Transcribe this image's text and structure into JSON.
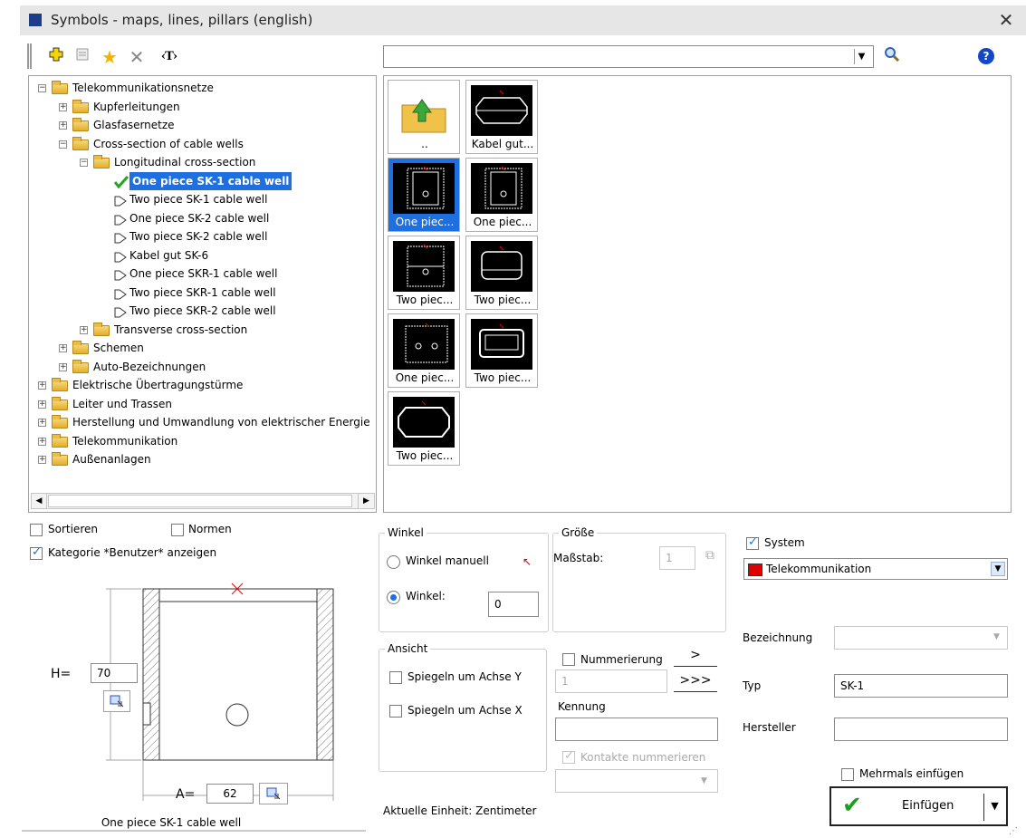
{
  "window": {
    "title": "Symbols - maps, lines, pillars (english)"
  },
  "toolbar": {
    "text_tool": "‹T›"
  },
  "search": {
    "placeholder": ""
  },
  "tree": {
    "items": [
      {
        "label": "Telekommunikationsnetze",
        "level": 0,
        "type": "folder",
        "expanded": true
      },
      {
        "label": "Kupferleitungen",
        "level": 1,
        "type": "folder",
        "expanded": false
      },
      {
        "label": "Glasfasernetze",
        "level": 1,
        "type": "folder",
        "expanded": false
      },
      {
        "label": "Cross-section of cable wells",
        "level": 1,
        "type": "folder",
        "expanded": true
      },
      {
        "label": "Longitudinal cross-section",
        "level": 2,
        "type": "folder",
        "expanded": true
      },
      {
        "label": "One piece SK-1 cable well",
        "level": 3,
        "type": "symbol",
        "selected": true
      },
      {
        "label": "Two piece SK-1 cable well",
        "level": 3,
        "type": "symbol"
      },
      {
        "label": "One piece SK-2 cable well",
        "level": 3,
        "type": "symbol"
      },
      {
        "label": "Two piece SK-2 cable well",
        "level": 3,
        "type": "symbol"
      },
      {
        "label": "Kabel gut SK-6",
        "level": 3,
        "type": "symbol"
      },
      {
        "label": "One piece SKR-1 cable well",
        "level": 3,
        "type": "symbol"
      },
      {
        "label": "Two piece SKR-1 cable well",
        "level": 3,
        "type": "symbol"
      },
      {
        "label": "Two piece SKR-2 cable well",
        "level": 3,
        "type": "symbol"
      },
      {
        "label": "Transverse cross-section",
        "level": 2,
        "type": "folder",
        "expanded": false
      },
      {
        "label": "Schemen",
        "level": 1,
        "type": "folder",
        "expanded": false
      },
      {
        "label": "Auto-Bezeichnungen",
        "level": 1,
        "type": "folder",
        "expanded": false
      },
      {
        "label": "Elektrische Übertragungstürme",
        "level": 0,
        "type": "folder",
        "expanded": false
      },
      {
        "label": "Leiter und Trassen",
        "level": 0,
        "type": "folder",
        "expanded": false
      },
      {
        "label": "Herstellung und Umwandlung von elektrischer Energie",
        "level": 0,
        "type": "folder",
        "expanded": false
      },
      {
        "label": "Telekommunikation",
        "level": 0,
        "type": "folder",
        "expanded": false
      },
      {
        "label": "Außenanlagen",
        "level": 0,
        "type": "folder",
        "expanded": false
      }
    ]
  },
  "thumbnails": [
    {
      "label": "..",
      "kind": "folder-up"
    },
    {
      "label": "Kabel gut...",
      "kind": "octagon"
    },
    {
      "label": "One piec...",
      "kind": "well",
      "selected": true
    },
    {
      "label": "One piec...",
      "kind": "well"
    },
    {
      "label": "Two piec...",
      "kind": "well2"
    },
    {
      "label": "Two piec...",
      "kind": "box"
    },
    {
      "label": "One piec...",
      "kind": "well3"
    },
    {
      "label": "Two piec...",
      "kind": "box2"
    },
    {
      "label": "Two piec...",
      "kind": "octagon2"
    }
  ],
  "options": {
    "sortieren": "Sortieren",
    "normen": "Normen",
    "kategorie": "Kategorie *Benutzer* anzeigen"
  },
  "preview": {
    "h_label": "H=",
    "h_value": "70",
    "a_label": "A=",
    "a_value": "62",
    "caption": "One piece SK-1 cable well"
  },
  "winkel": {
    "title": "Winkel",
    "manual_label": "Winkel manuell",
    "angle_label": "Winkel:",
    "angle_value": "0"
  },
  "groesse": {
    "title": "Größe",
    "scale_label": "Maßstab:",
    "scale_value": "1"
  },
  "ansicht": {
    "title": "Ansicht",
    "mirror_y": "Spiegeln um Achse Y",
    "mirror_x": "Spiegeln um Achse X"
  },
  "numbering": {
    "label": "Nummerierung",
    "value": "1",
    "next": ">",
    "next_all": ">>>",
    "kennung_label": "Kennung",
    "kennung_value": "",
    "kontakte": "Kontakte nummerieren"
  },
  "unit_text": "Aktuelle Einheit: Zentimeter",
  "system": {
    "label": "System",
    "selected": "Telekommunikation",
    "color": "#e00000"
  },
  "fields": {
    "bezeichnung_label": "Bezeichnung",
    "bezeichnung_value": "",
    "typ_label": "Typ",
    "typ_value": "SK-1",
    "hersteller_label": "Hersteller",
    "hersteller_value": ""
  },
  "insert": {
    "multiple_label": "Mehrmals einfügen",
    "button_label": "Einfügen"
  }
}
